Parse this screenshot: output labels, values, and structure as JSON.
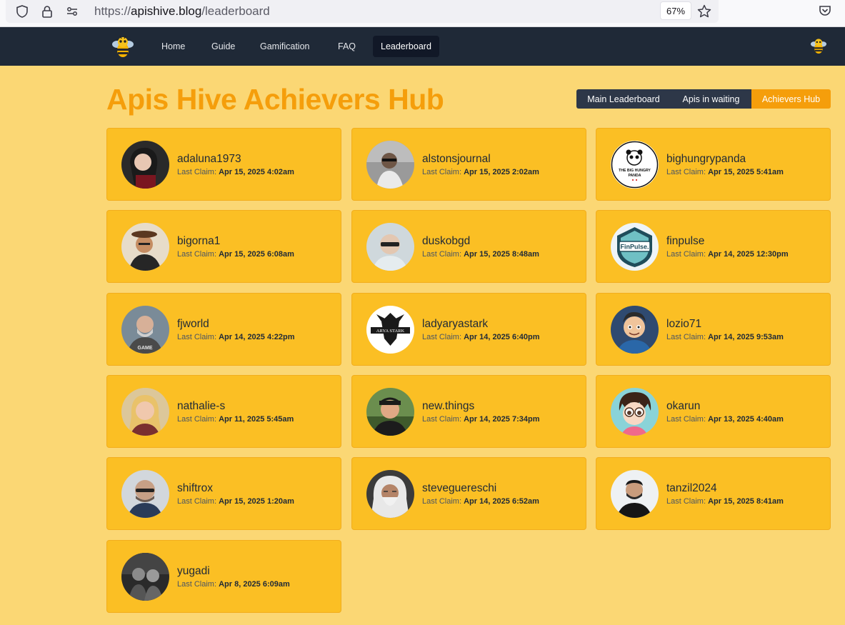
{
  "browser": {
    "url_scheme": "https://",
    "url_host": "apishive.blog",
    "url_path": "/leaderboard",
    "zoom": "67%"
  },
  "nav": {
    "items": [
      {
        "label": "Home"
      },
      {
        "label": "Guide"
      },
      {
        "label": "Gamification"
      },
      {
        "label": "FAQ"
      },
      {
        "label": "Leaderboard",
        "active": true
      }
    ]
  },
  "header": {
    "title": "Apis Hive Achievers Hub",
    "tabs": [
      {
        "label": "Main Leaderboard"
      },
      {
        "label": "Apis in waiting"
      },
      {
        "label": "Achievers Hub",
        "active": true
      }
    ]
  },
  "claim_label": "Last Claim:",
  "colors": {
    "accent": "#f59e0b",
    "page_bg": "#fbd774",
    "card_bg": "#fbbf24",
    "nav_bg": "#1f2937"
  },
  "achievers": [
    {
      "username": "adaluna1973",
      "last_claim": "Apr 15, 2025 4:02am"
    },
    {
      "username": "alstonsjournal",
      "last_claim": "Apr 15, 2025 2:02am"
    },
    {
      "username": "bighungrypanda",
      "last_claim": "Apr 15, 2025 5:41am",
      "avatar_text": "THE BIG HUNGRY PANDA"
    },
    {
      "username": "bigorna1",
      "last_claim": "Apr 15, 2025 6:08am"
    },
    {
      "username": "duskobgd",
      "last_claim": "Apr 15, 2025 8:48am"
    },
    {
      "username": "finpulse",
      "last_claim": "Apr 14, 2025 12:30pm",
      "avatar_text": "FinPulse."
    },
    {
      "username": "fjworld",
      "last_claim": "Apr 14, 2025 4:22pm"
    },
    {
      "username": "ladyaryastark",
      "last_claim": "Apr 14, 2025 6:40pm"
    },
    {
      "username": "lozio71",
      "last_claim": "Apr 14, 2025 9:53am"
    },
    {
      "username": "nathalie-s",
      "last_claim": "Apr 11, 2025 5:45am"
    },
    {
      "username": "new.things",
      "last_claim": "Apr 14, 2025 7:34pm"
    },
    {
      "username": "okarun",
      "last_claim": "Apr 13, 2025 4:40am"
    },
    {
      "username": "shiftrox",
      "last_claim": "Apr 15, 2025 1:20am"
    },
    {
      "username": "steveguereschi",
      "last_claim": "Apr 14, 2025 6:52am"
    },
    {
      "username": "tanzil2024",
      "last_claim": "Apr 15, 2025 8:41am"
    },
    {
      "username": "yugadi",
      "last_claim": "Apr 8, 2025 6:09am"
    }
  ]
}
